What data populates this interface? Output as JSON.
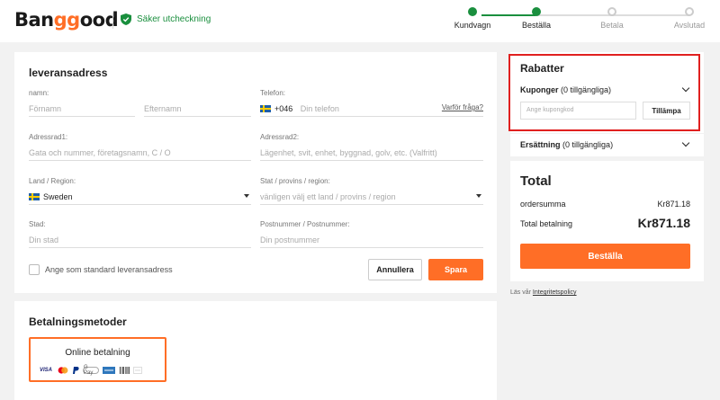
{
  "header": {
    "logo_pre": "Ban",
    "logo_gg": "gg",
    "logo_post": "ood",
    "secure_text": "Säker utcheckning",
    "steps": [
      {
        "label": "Kundvagn",
        "state": "done"
      },
      {
        "label": "Beställa",
        "state": "done"
      },
      {
        "label": "Betala",
        "state": "todo"
      },
      {
        "label": "Avslutad",
        "state": "todo"
      }
    ]
  },
  "address": {
    "title": "leveransadress",
    "name_label": "namn:",
    "first_placeholder": "Förnamn",
    "last_placeholder": "Efternamn",
    "phone_label": "Telefon:",
    "phone_code": "+046",
    "phone_placeholder": "Din telefon",
    "why_link": "Varför fråga?",
    "addr1_label": "Adressrad1:",
    "addr1_placeholder": "Gata och nummer, företagsnamn, C / O",
    "addr2_label": "Adressrad2:",
    "addr2_placeholder": "Lägenhet, svit, enhet, byggnad, golv, etc. (Valfritt)",
    "country_label": "Land / Region:",
    "country_value": "Sweden",
    "state_label": "Stat / provins / region:",
    "state_placeholder": "vänligen välj ett land / provins / region",
    "city_label": "Stad:",
    "city_placeholder": "Din stad",
    "postal_label": "Postnummer / Postnummer:",
    "postal_placeholder": "Din postnummer",
    "default_label": "Ange som standard leveransadress",
    "cancel_label": "Annullera",
    "save_label": "Spara"
  },
  "payment": {
    "title": "Betalningsmetoder",
    "method_label": "Online betalning",
    "icons": [
      "visa-icon",
      "mastercard-icon",
      "paypal-icon",
      "gpay-icon",
      "amex-icon",
      "barcode-icon",
      "more-icon"
    ],
    "visa_text": "VISA",
    "gpay_text": "G Pay"
  },
  "discounts": {
    "title": "Rabatter",
    "coupons_label": "Kuponger",
    "coupons_count": "(0 tillgängliga)",
    "coupon_placeholder": "Ange kupongkod",
    "apply_label": "Tillämpa",
    "compensation_label": "Ersättning",
    "compensation_count": "(0 tillgängliga)"
  },
  "total": {
    "title": "Total",
    "subtotal_label": "ordersumma",
    "subtotal_value": "Kr871.18",
    "total_label": "Total betalning",
    "total_value": "Kr871.18",
    "order_button": "Beställa"
  },
  "privacy": {
    "prefix": "Läs vår",
    "link": "Integritetspolicy"
  },
  "colors": {
    "accent": "#ff6e26",
    "success": "#1a8f3e",
    "highlight": "#e0201f"
  }
}
